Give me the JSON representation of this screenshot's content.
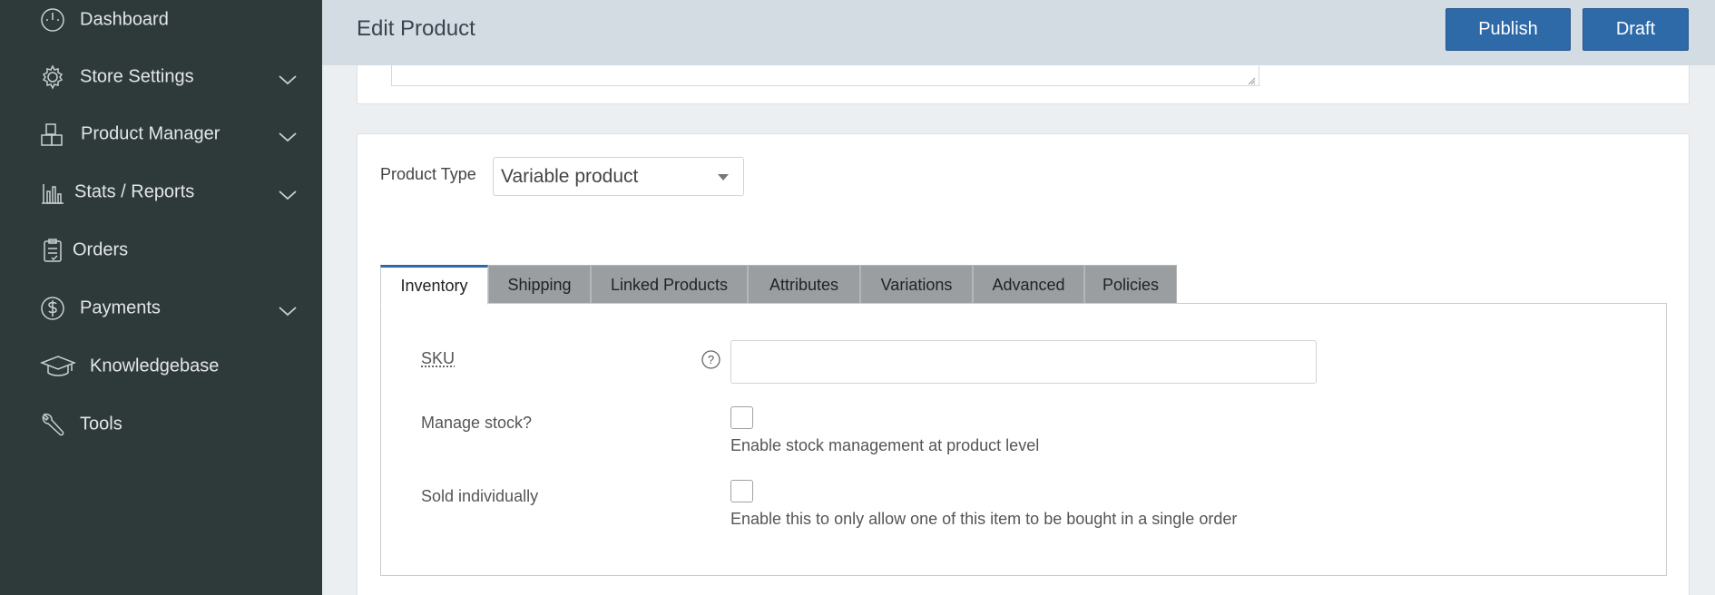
{
  "sidebar": {
    "items": [
      {
        "label": "Dashboard",
        "icon": "dashboard-icon",
        "has_submenu": false
      },
      {
        "label": "Store Settings",
        "icon": "gear-icon",
        "has_submenu": true
      },
      {
        "label": "Product Manager",
        "icon": "boxes-icon",
        "has_submenu": true
      },
      {
        "label": "Stats / Reports",
        "icon": "bar-chart-icon",
        "has_submenu": true
      },
      {
        "label": "Orders",
        "icon": "clipboard-icon",
        "has_submenu": false
      },
      {
        "label": "Payments",
        "icon": "dollar-icon",
        "has_submenu": true
      },
      {
        "label": "Knowledgebase",
        "icon": "graduation-cap-icon",
        "has_submenu": false
      },
      {
        "label": "Tools",
        "icon": "wrench-icon",
        "has_submenu": false
      }
    ]
  },
  "header": {
    "title": "Edit Product",
    "publish_label": "Publish",
    "draft_label": "Draft"
  },
  "product_type": {
    "label": "Product Type",
    "selected": "Variable product"
  },
  "tabs": [
    {
      "label": "Inventory",
      "active": true
    },
    {
      "label": "Shipping",
      "active": false
    },
    {
      "label": "Linked Products",
      "active": false
    },
    {
      "label": "Attributes",
      "active": false
    },
    {
      "label": "Variations",
      "active": false
    },
    {
      "label": "Advanced",
      "active": false
    },
    {
      "label": "Policies",
      "active": false
    }
  ],
  "inventory": {
    "sku_label": "SKU",
    "sku_value": "",
    "manage_stock_label": "Manage stock?",
    "manage_stock_desc": "Enable stock management at product level",
    "manage_stock_checked": false,
    "sold_individually_label": "Sold individually",
    "sold_individually_desc": "Enable this to only allow one of this item to be bought in a single order",
    "sold_individually_checked": false
  },
  "colors": {
    "sidebar_bg": "#2e3a3a",
    "header_bg": "#d4dce3",
    "primary_button": "#2e6aa8",
    "tab_inactive": "#9b9ea1"
  }
}
